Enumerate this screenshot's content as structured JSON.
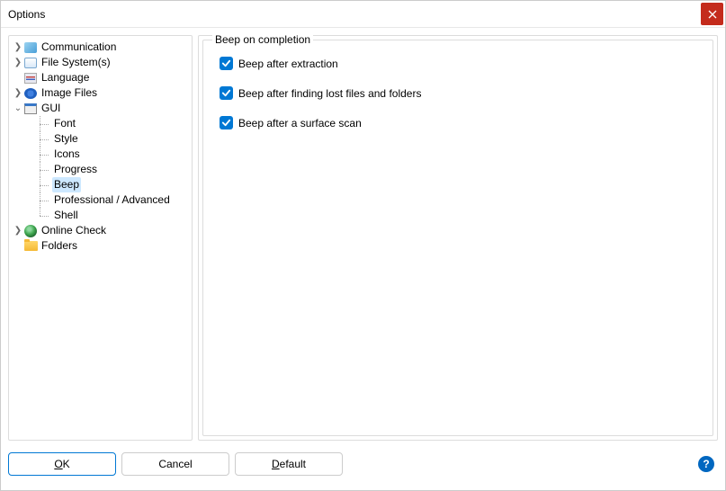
{
  "window": {
    "title": "Options"
  },
  "tree": {
    "items": [
      {
        "label": "Communication",
        "expandable": true,
        "icon": "comm"
      },
      {
        "label": "File System(s)",
        "expandable": true,
        "icon": "fs"
      },
      {
        "label": "Language",
        "expandable": false,
        "icon": "lang"
      },
      {
        "label": "Image Files",
        "expandable": true,
        "icon": "img"
      },
      {
        "label": "GUI",
        "expandable": true,
        "expanded": true,
        "icon": "gui"
      },
      {
        "label": "Online Check",
        "expandable": true,
        "icon": "online"
      },
      {
        "label": "Folders",
        "expandable": false,
        "icon": "folder"
      }
    ],
    "gui_children": [
      {
        "label": "Font"
      },
      {
        "label": "Style"
      },
      {
        "label": "Icons"
      },
      {
        "label": "Progress"
      },
      {
        "label": "Beep",
        "selected": true
      },
      {
        "label": "Professional / Advanced"
      },
      {
        "label": "Shell"
      }
    ]
  },
  "panel": {
    "groupTitle": "Beep on completion",
    "checks": [
      {
        "label": "Beep after extraction",
        "checked": true
      },
      {
        "label": "Beep after finding lost files and folders",
        "checked": true
      },
      {
        "label": "Beep after a surface scan",
        "checked": true
      }
    ]
  },
  "buttons": {
    "ok": "OK",
    "cancel": "Cancel",
    "default": "Default"
  }
}
